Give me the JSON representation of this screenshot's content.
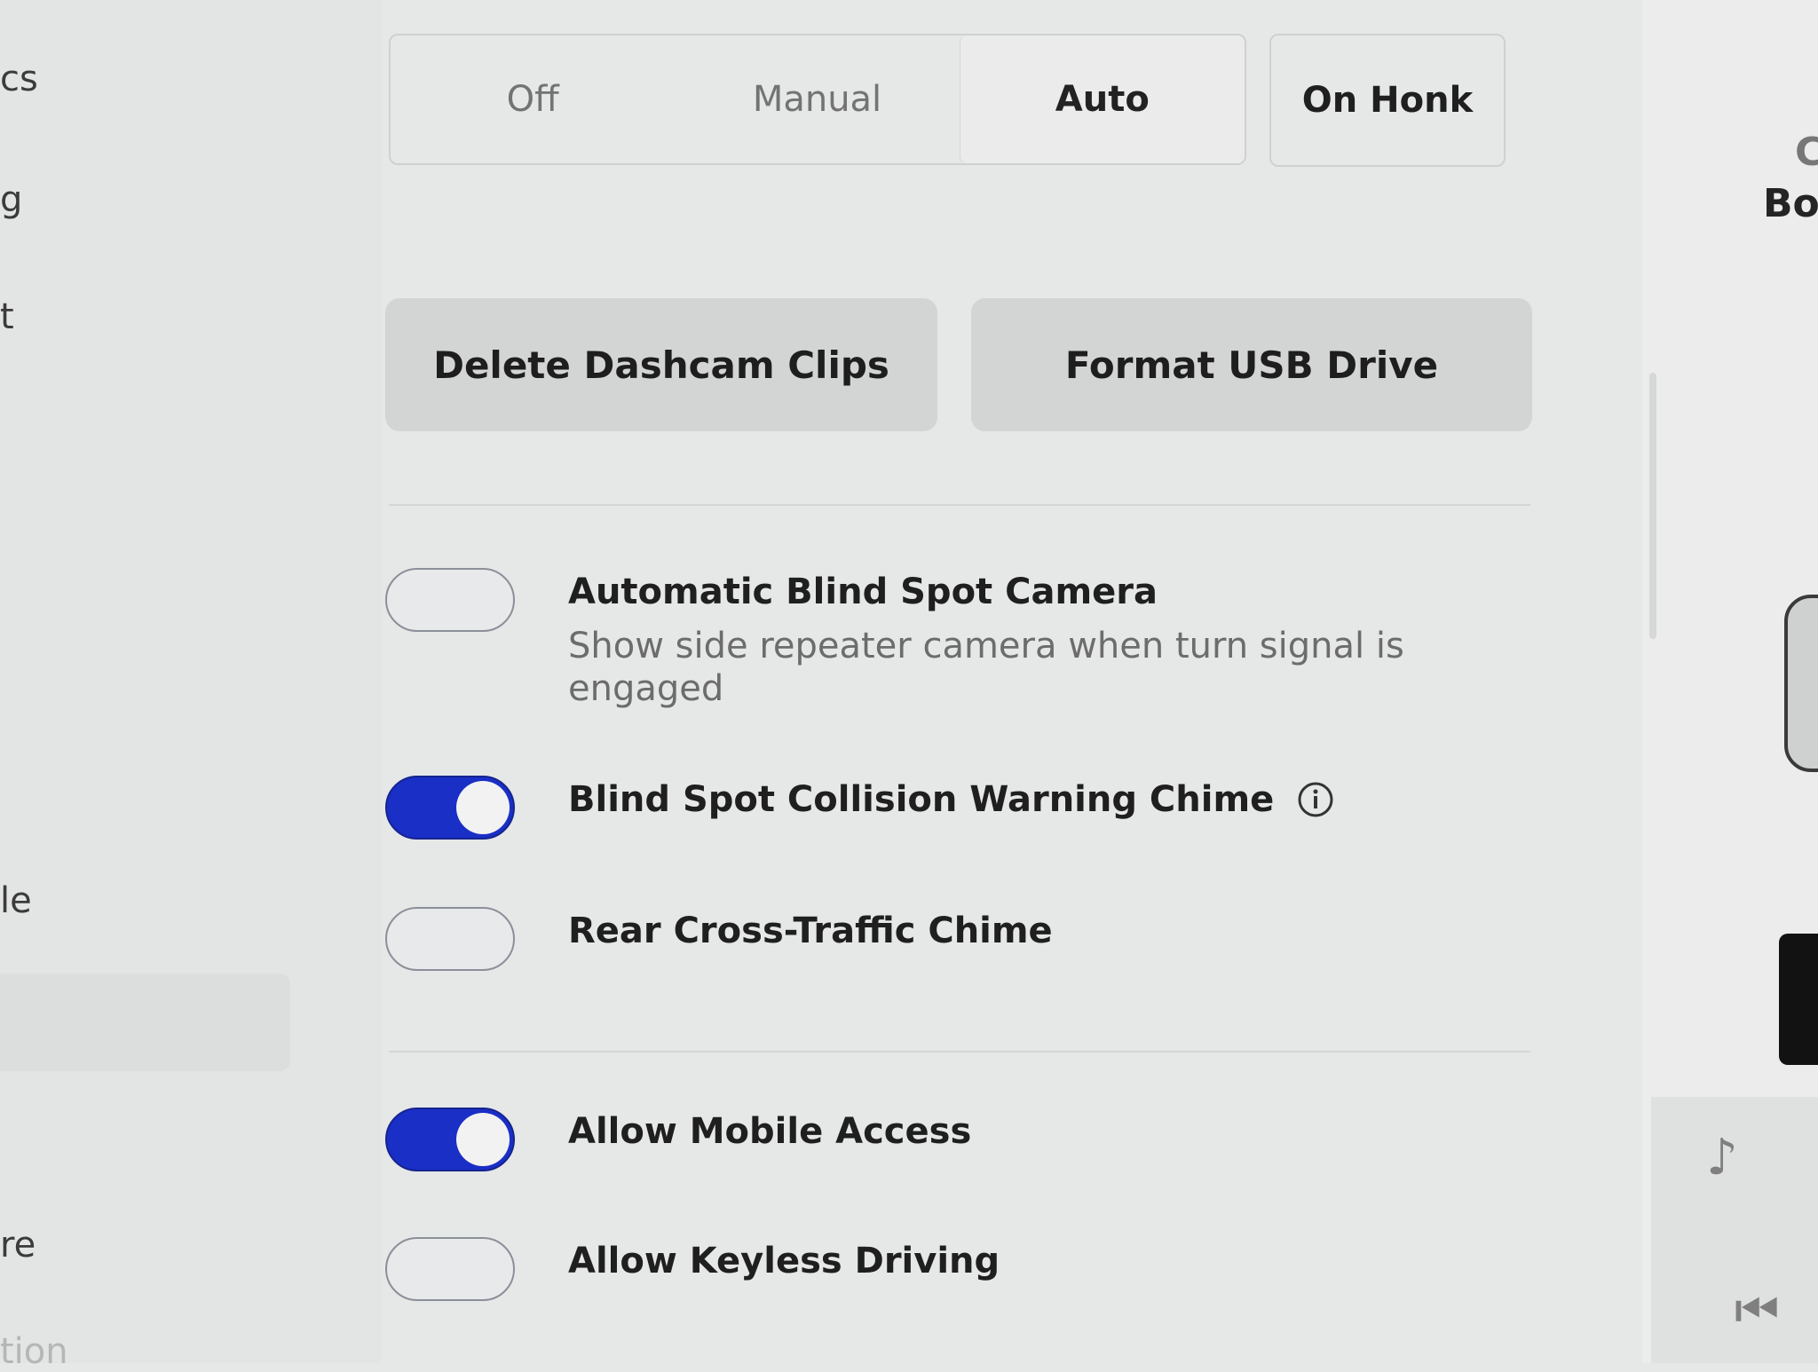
{
  "sidebar": {
    "fragments": [
      "cs",
      "g",
      "t",
      "le",
      "re",
      "tion"
    ]
  },
  "dashcam": {
    "options": [
      "Off",
      "Manual",
      "Auto"
    ],
    "selected": "Auto",
    "on_honk_label": "On Honk"
  },
  "actions": {
    "delete_clips_label": "Delete Dashcam Clips",
    "format_usb_label": "Format USB Drive"
  },
  "settings": [
    {
      "label": "Automatic Blind Spot Camera",
      "description": "Show side repeater camera when turn signal is engaged",
      "enabled": false
    },
    {
      "label": "Blind Spot Collision Warning Chime",
      "description": "",
      "enabled": true,
      "icon": "info-icon"
    },
    {
      "label": "Rear Cross-Traffic Chime",
      "description": "",
      "enabled": false
    },
    {
      "label": "Allow Mobile Access",
      "description": "",
      "enabled": true
    },
    {
      "label": "Allow Keyless Driving",
      "description": "",
      "enabled": false
    }
  ],
  "right_edge": {
    "fragment_top": "C",
    "fragment_main": "Bo"
  },
  "colors": {
    "toggle_on": "#1a2fc6",
    "background": "#e6e7e7",
    "button_bg": "#d3d4d4"
  }
}
